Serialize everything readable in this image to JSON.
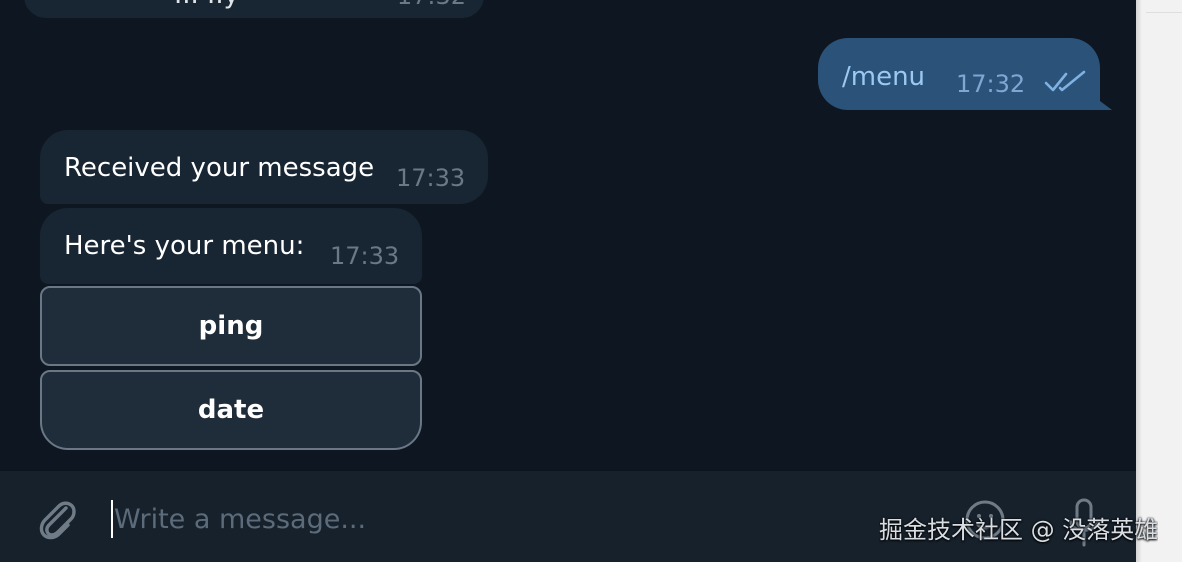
{
  "previous_message": {
    "visible_text": "... ..y",
    "time": "17:32"
  },
  "outgoing_message": {
    "text": "/menu",
    "time": "17:32",
    "status_icon": "double-check-icon"
  },
  "incoming_messages": [
    {
      "text": "Received your message",
      "time": "17:33"
    },
    {
      "text": "Here's your menu:",
      "time": "17:33"
    }
  ],
  "inline_keyboard": [
    {
      "label": "ping"
    },
    {
      "label": "date"
    }
  ],
  "composer": {
    "placeholder": "Write a message...",
    "attach_icon": "paperclip-icon",
    "emoji_icon": "smiley-icon",
    "mic_icon": "microphone-icon"
  },
  "watermark": "掘金技术社区 @ 没落英雄",
  "colors": {
    "background": "#0e1621",
    "incoming_bubble": "#182533",
    "outgoing_bubble": "#2b5278",
    "composer_bg": "#17212b",
    "button_border": "#6a7786"
  }
}
